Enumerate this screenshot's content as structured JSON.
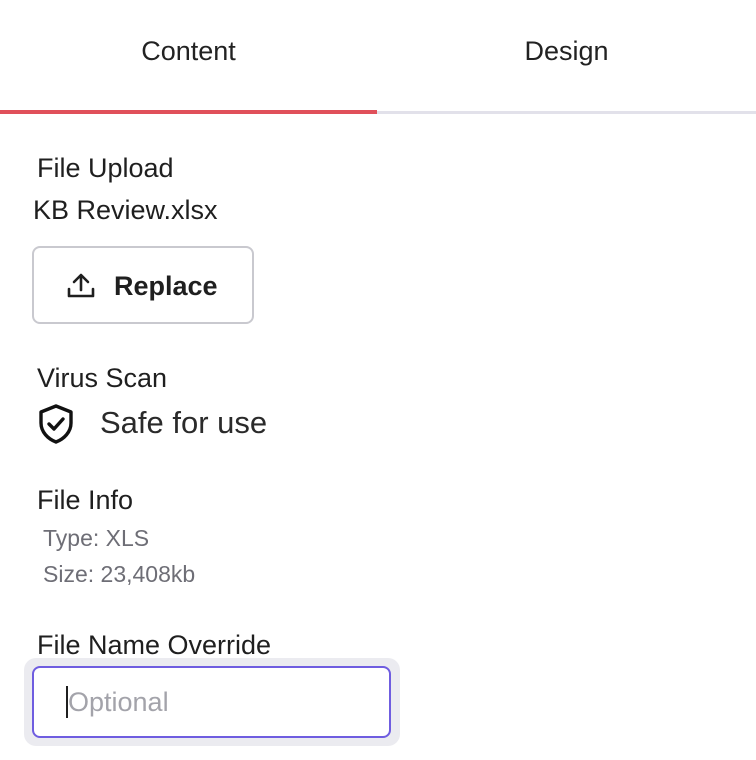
{
  "tabs": {
    "content_label": "Content",
    "design_label": "Design",
    "active": "Content",
    "active_color": "#e0505a"
  },
  "file_upload": {
    "label": "File Upload",
    "filename": "KB Review.xlsx",
    "replace_label": "Replace",
    "replace_icon": "upload-icon"
  },
  "virus_scan": {
    "label": "Virus Scan",
    "status": "Safe for use",
    "status_icon": "shield-check-icon"
  },
  "file_info": {
    "label": "File Info",
    "type_line": "Type: XLS",
    "size_line": "Size: 23,408kb"
  },
  "override": {
    "label": "File Name Override",
    "placeholder": "Optional",
    "value": "",
    "focus_color": "#6f5de0"
  }
}
